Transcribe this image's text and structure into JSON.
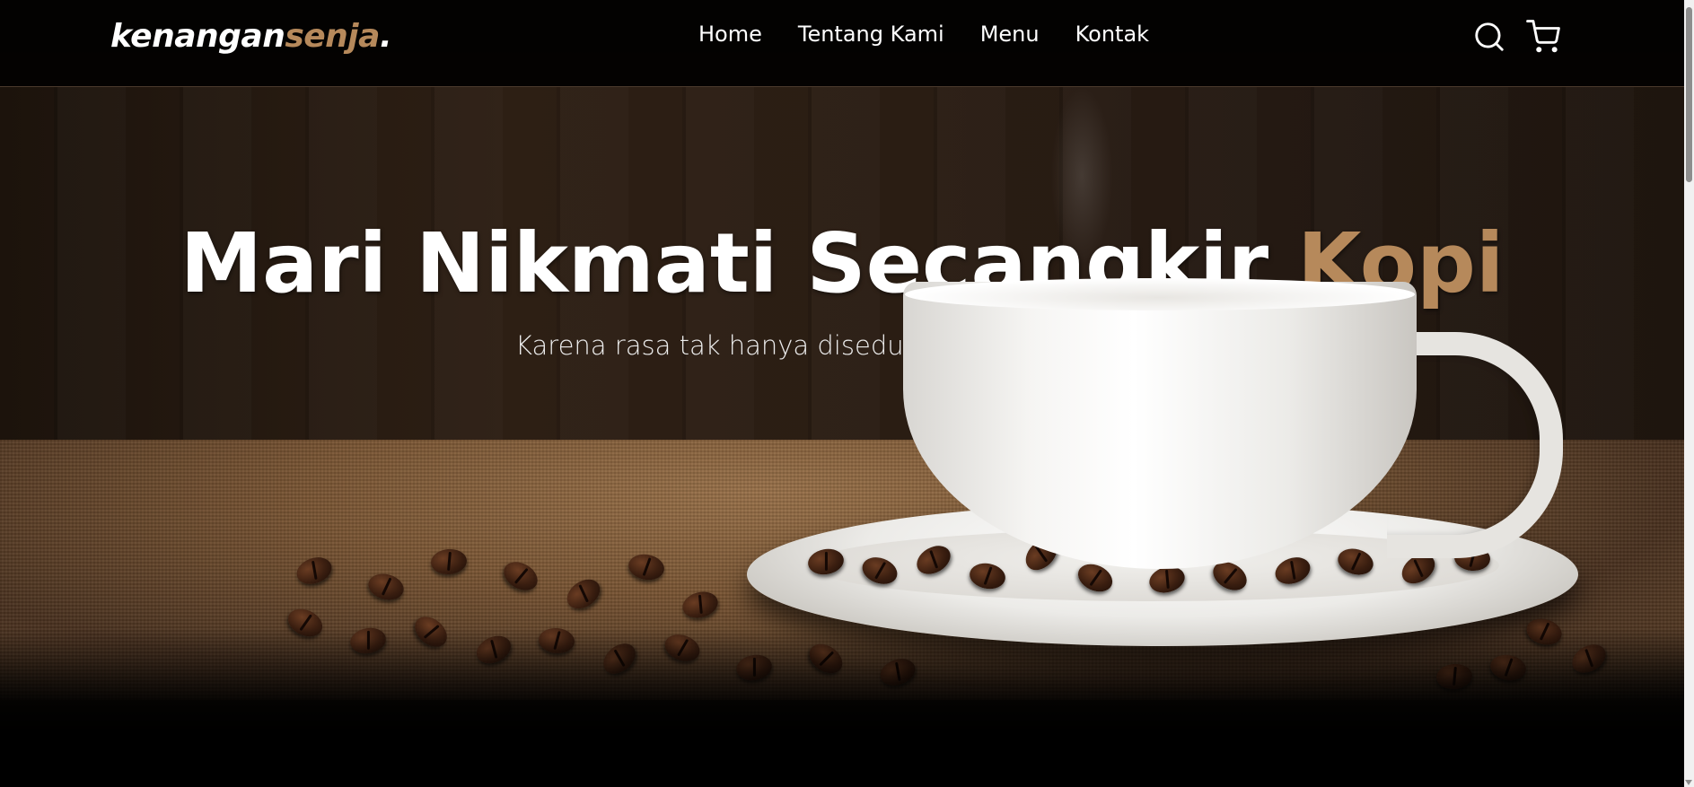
{
  "brand": {
    "name_main": "kenangan",
    "name_accent": "senja",
    "name_dot": "."
  },
  "nav": {
    "items": [
      {
        "label": "Home"
      },
      {
        "label": "Tentang Kami"
      },
      {
        "label": "Menu"
      },
      {
        "label": "Kontak"
      }
    ],
    "icons": [
      "search-icon",
      "shopping-cart-icon"
    ]
  },
  "hero": {
    "title_main": "Mari Nikmati Secangkir ",
    "title_accent": "Kopi",
    "subtitle": "Karena rasa tak hanya diseduh,"
  },
  "colors": {
    "accent": "#b6895b",
    "navbar_bg": "#000000",
    "text": "#ffffff"
  }
}
